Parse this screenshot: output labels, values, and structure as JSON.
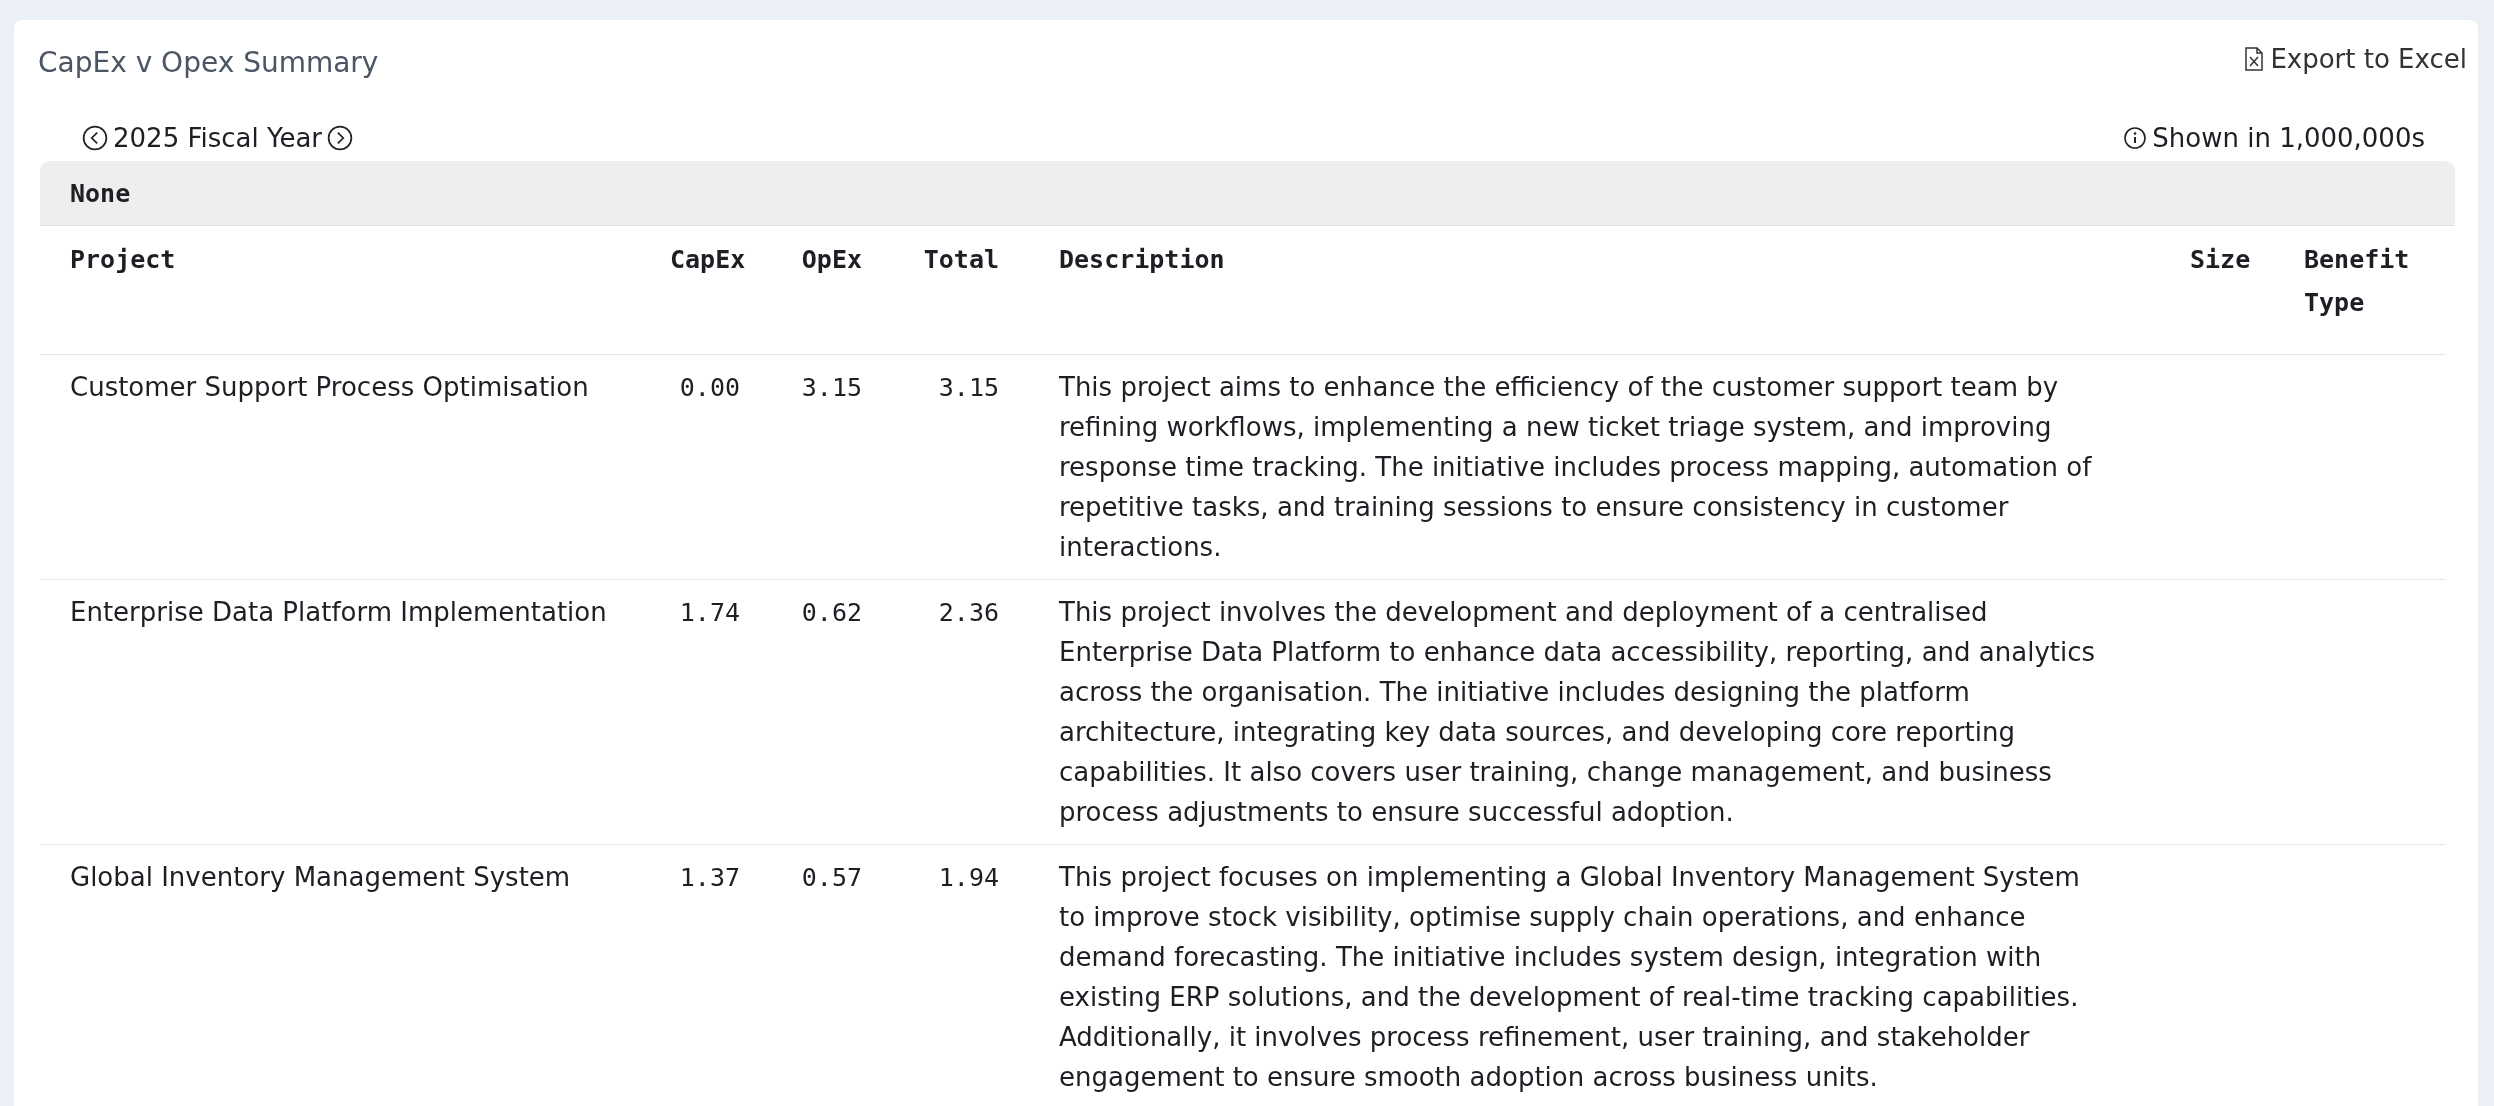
{
  "card": {
    "title": "CapEx v Opex Summary",
    "export_button": "Export to Excel"
  },
  "period": {
    "label": "2025 Fiscal Year",
    "units_note": "Shown in 1,000,000s"
  },
  "table": {
    "group": "None",
    "columns": [
      {
        "label": "Project",
        "kind": "text"
      },
      {
        "label": "CapEx",
        "kind": "number"
      },
      {
        "label": "OpEx",
        "kind": "number"
      },
      {
        "label": "Total",
        "kind": "number"
      },
      {
        "label": "Description",
        "kind": "text"
      },
      {
        "label": "Size",
        "kind": "number"
      },
      {
        "label": "Benefit Type",
        "kind": "text"
      }
    ],
    "rows": [
      {
        "project": "Customer Support Process Optimisation",
        "capex": "0.00",
        "opex": "3.15",
        "total": "3.15",
        "description": "This project aims to enhance the efficiency of the customer support team by refining workflows, implementing a new ticket triage system, and improving response time tracking. The initiative includes process mapping, automation of repetitive tasks, and training sessions to ensure consistency in customer interactions."
      },
      {
        "project": "Enterprise Data Platform Implementation",
        "capex": "1.74",
        "opex": "0.62",
        "total": "2.36",
        "description": "This project involves the development and deployment of a centralised Enterprise Data Platform to enhance data accessibility, reporting, and analytics across the organisation. The initiative includes designing the platform architecture, integrating key data sources, and developing core reporting capabilities. It also covers user training, change management, and business process adjustments to ensure successful adoption."
      },
      {
        "project": "Global Inventory Management System",
        "capex": "1.37",
        "opex": "0.57",
        "total": "1.94",
        "description": "This project focuses on implementing a Global Inventory Management System to improve stock visibility, optimise supply chain operations, and enhance demand forecasting. The initiative includes system design, integration with existing ERP solutions, and the development of real-time tracking capabilities. Additionally, it involves process refinement, user training, and stakeholder engagement to ensure smooth adoption across business units."
      }
    ]
  }
}
